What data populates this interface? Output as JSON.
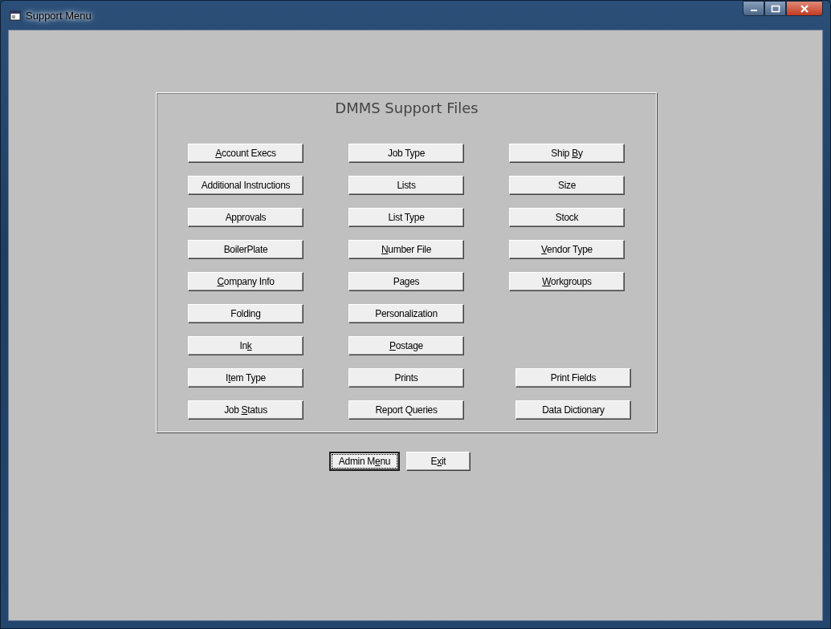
{
  "window": {
    "title": "Support Menu"
  },
  "panel": {
    "title": "DMMS Support Files",
    "columns": [
      {
        "groups": [
          [
            {
              "key": "A",
              "after": "ccount Execs"
            },
            {
              "before": "Additional Instructions"
            },
            {
              "before": "Approvals"
            },
            {
              "before": "BoilerPlate"
            },
            {
              "key": "C",
              "after": "ompany Info"
            },
            {
              "before": "Folding"
            },
            {
              "before": "In",
              "key": "k"
            },
            {
              "before": "I",
              "key": "t",
              "after": "em Type"
            },
            {
              "before": "Job ",
              "key": "S",
              "after": "tatus"
            }
          ]
        ]
      },
      {
        "groups": [
          [
            {
              "before": "Job Type"
            },
            {
              "before": "Lists"
            },
            {
              "before": "List Type"
            },
            {
              "key": "N",
              "after": "umber File"
            },
            {
              "before": "Pages"
            },
            {
              "before": "Personalization"
            },
            {
              "key": "P",
              "after": "ostage"
            },
            {
              "before": "Prints"
            },
            {
              "before": "Report Queries"
            }
          ]
        ]
      },
      {
        "groups": [
          [
            {
              "before": "Ship ",
              "key": "B",
              "after": "y"
            },
            {
              "before": "Size"
            },
            {
              "before": "Stock"
            },
            {
              "key": "V",
              "after": "endor Type"
            },
            {
              "key": "W",
              "after": "orkgroups"
            }
          ],
          [
            {
              "before": "Print Fields"
            },
            {
              "before": "Data Dictionary"
            }
          ]
        ]
      }
    ]
  },
  "buttons": [
    {
      "before": "Admin M",
      "key": "e",
      "after": "nu",
      "focused": true
    },
    {
      "before": "E",
      "key": "x",
      "after": "it",
      "focused": false
    }
  ]
}
